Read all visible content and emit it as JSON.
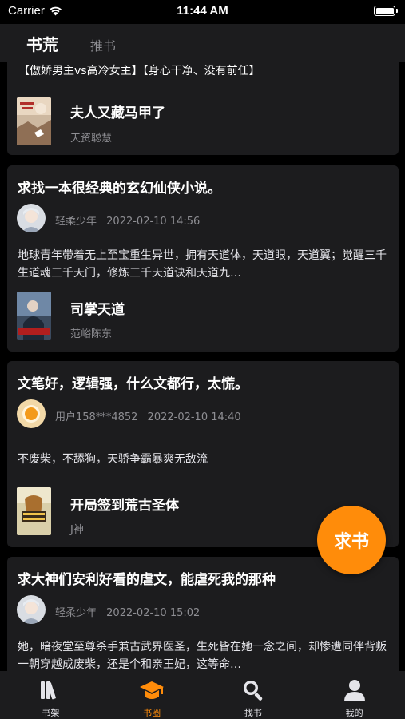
{
  "status_bar": {
    "carrier": "Carrier",
    "time": "11:44 AM"
  },
  "header": {
    "tabs": [
      {
        "label": "书荒",
        "active": true
      },
      {
        "label": "推书",
        "active": false
      }
    ]
  },
  "posts": [
    {
      "tags": "【傲娇男主vs高冷女主】【身心干净、没有前任】",
      "book": {
        "title": "夫人又藏马甲了",
        "author": "天资聪慧"
      }
    },
    {
      "title": "求找一本很经典的玄幻仙侠小说。",
      "user": "轻柔少年",
      "time": "2022-02-10 14:56",
      "body": "地球青年带着无上至宝重生异世，拥有天道体，天道眼，天道翼；觉醒三千生道魂三千天门，修炼三千天道诀和天道九…",
      "book": {
        "title": "司掌天道",
        "author": "范峪陈东"
      }
    },
    {
      "title": "文笔好，逻辑强，什么文都行，太慌。",
      "user": "用户158***4852",
      "time": "2022-02-10 14:40",
      "body": "不废柴，不舔狗，天骄争霸暴爽无敌流",
      "book": {
        "title": "开局签到荒古圣体",
        "author": "J神"
      }
    },
    {
      "title": "求大神们安利好看的虐文，能虐死我的那种",
      "user": "轻柔少年",
      "time": "2022-02-10 15:02",
      "body": "她，暗夜堂至尊杀手兼古武界医圣，生死皆在她一念之间，却惨遭同伴背叛一朝穿越成废柴，还是个和亲王妃，这等命…"
    }
  ],
  "fab": {
    "label": "求书"
  },
  "tabbar": [
    {
      "label": "书架",
      "icon": "books-icon"
    },
    {
      "label": "书圈",
      "icon": "graduation-cap-icon",
      "active": true
    },
    {
      "label": "找书",
      "icon": "search-icon"
    },
    {
      "label": "我的",
      "icon": "user-icon"
    }
  ],
  "colors": {
    "accent": "#ff8c0a",
    "card": "#1c1c1e",
    "background": "#000000",
    "muted": "#8e8e93"
  }
}
